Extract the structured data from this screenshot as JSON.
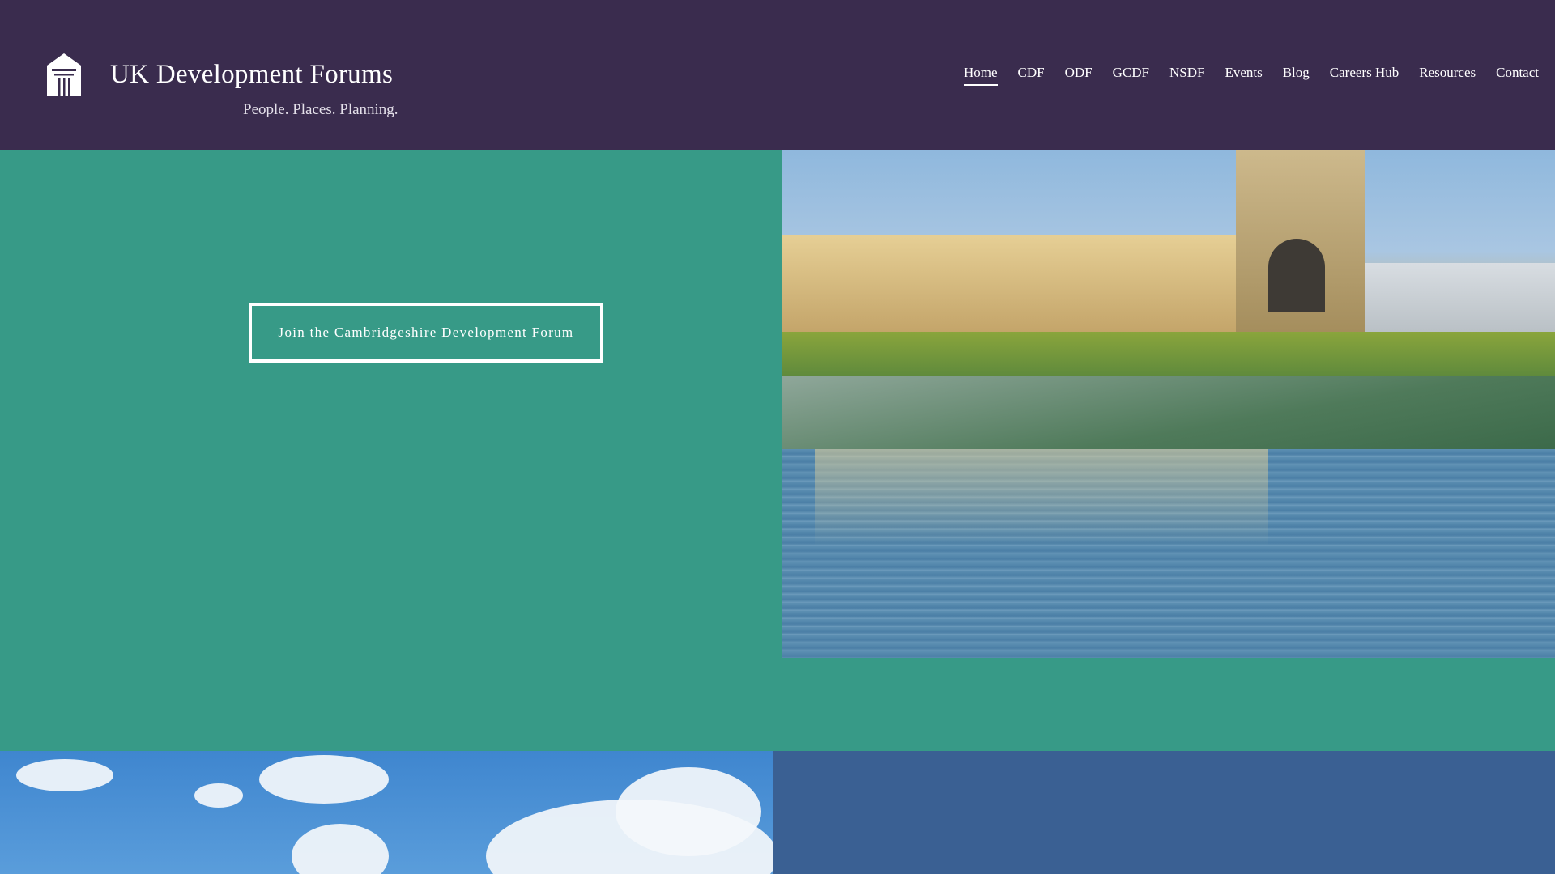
{
  "header": {
    "logo": {
      "title": "UK Development Forums",
      "tagline": "People. Places. Planning.",
      "icon": "building-column-icon"
    },
    "nav": [
      {
        "label": "Home",
        "active": true
      },
      {
        "label": "CDF"
      },
      {
        "label": "ODF"
      },
      {
        "label": "GCDF"
      },
      {
        "label": "NSDF"
      },
      {
        "label": "Events"
      },
      {
        "label": "Blog"
      },
      {
        "label": "Careers Hub"
      },
      {
        "label": "Resources"
      },
      {
        "label": "Contact"
      }
    ]
  },
  "hero": {
    "cta_label": "Join the Cambridgeshire Development Forum"
  },
  "colors": {
    "header": "#3a2c4e",
    "teal": "#379a87",
    "blue": "#3a6093"
  }
}
